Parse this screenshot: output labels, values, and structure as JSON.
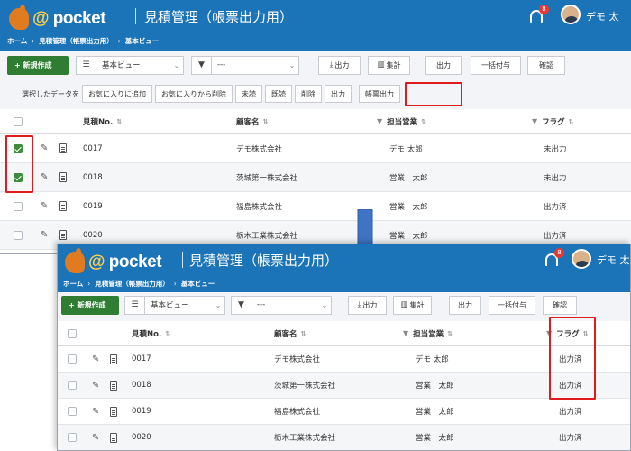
{
  "app": {
    "logo_at": "@",
    "logo_text": " pocket",
    "title": "見積管理（帳票出力用）",
    "notification_count": "8",
    "user_name_top": "デモ 太",
    "user_name_bottom": "デモ 太郎"
  },
  "breadcrumb": [
    "ホーム",
    "見積管理（帳票出力用）",
    "基本ビュー"
  ],
  "toolbar": {
    "new_label": "+ 新規作成",
    "view_value": "基本ビュー",
    "filter_value": "---",
    "export_label": "出力",
    "aggregate_label": "集計",
    "output_label": "出力",
    "bulk_label": "一括付与",
    "confirm_label": "確認"
  },
  "selection_bar": {
    "label": "選択したデータを",
    "buttons": [
      "お気に入りに追加",
      "お気に入りから削除",
      "未読",
      "既読",
      "削除",
      "出力",
      "帳票出力"
    ]
  },
  "table": {
    "headers": {
      "no": "見積No.",
      "customer": "顧客名",
      "sales": "担当営業",
      "flag": "フラグ"
    },
    "rows_before": [
      {
        "no": "0017",
        "customer": "デモ株式会社",
        "sales": "デモ 太郎",
        "flag": "未出力",
        "checked": true
      },
      {
        "no": "0018",
        "customer": "茨城第一株式会社",
        "sales": "営業　太郎",
        "flag": "未出力",
        "checked": true
      },
      {
        "no": "0019",
        "customer": "福島株式会社",
        "sales": "営業　太郎",
        "flag": "出力済",
        "checked": false
      },
      {
        "no": "0020",
        "customer": "栃木工業株式会社",
        "sales": "営業　太郎",
        "flag": "出力済",
        "checked": false
      }
    ],
    "rows_after": [
      {
        "no": "0017",
        "customer": "デモ株式会社",
        "sales": "デモ 太郎",
        "flag": "出力済"
      },
      {
        "no": "0018",
        "customer": "茨城第一株式会社",
        "sales": "営業　太郎",
        "flag": "出力済"
      },
      {
        "no": "0019",
        "customer": "福島株式会社",
        "sales": "営業　太郎",
        "flag": "出力済"
      },
      {
        "no": "0020",
        "customer": "栃木工業株式会社",
        "sales": "営業　太郎",
        "flag": "出力済"
      }
    ]
  },
  "colors": {
    "header_bg": "#1b73b8",
    "new_button": "#2e7d32",
    "highlight": "#e01b1b",
    "arrow": "#3f74c4"
  },
  "icons": [
    "kangaroo-logo-icon",
    "bell-icon",
    "avatar",
    "list-icon",
    "filter-icon",
    "download-icon",
    "bar-chart-icon",
    "pencil-icon",
    "document-icon",
    "sort-icon",
    "checkbox",
    "down-arrow-icon"
  ]
}
